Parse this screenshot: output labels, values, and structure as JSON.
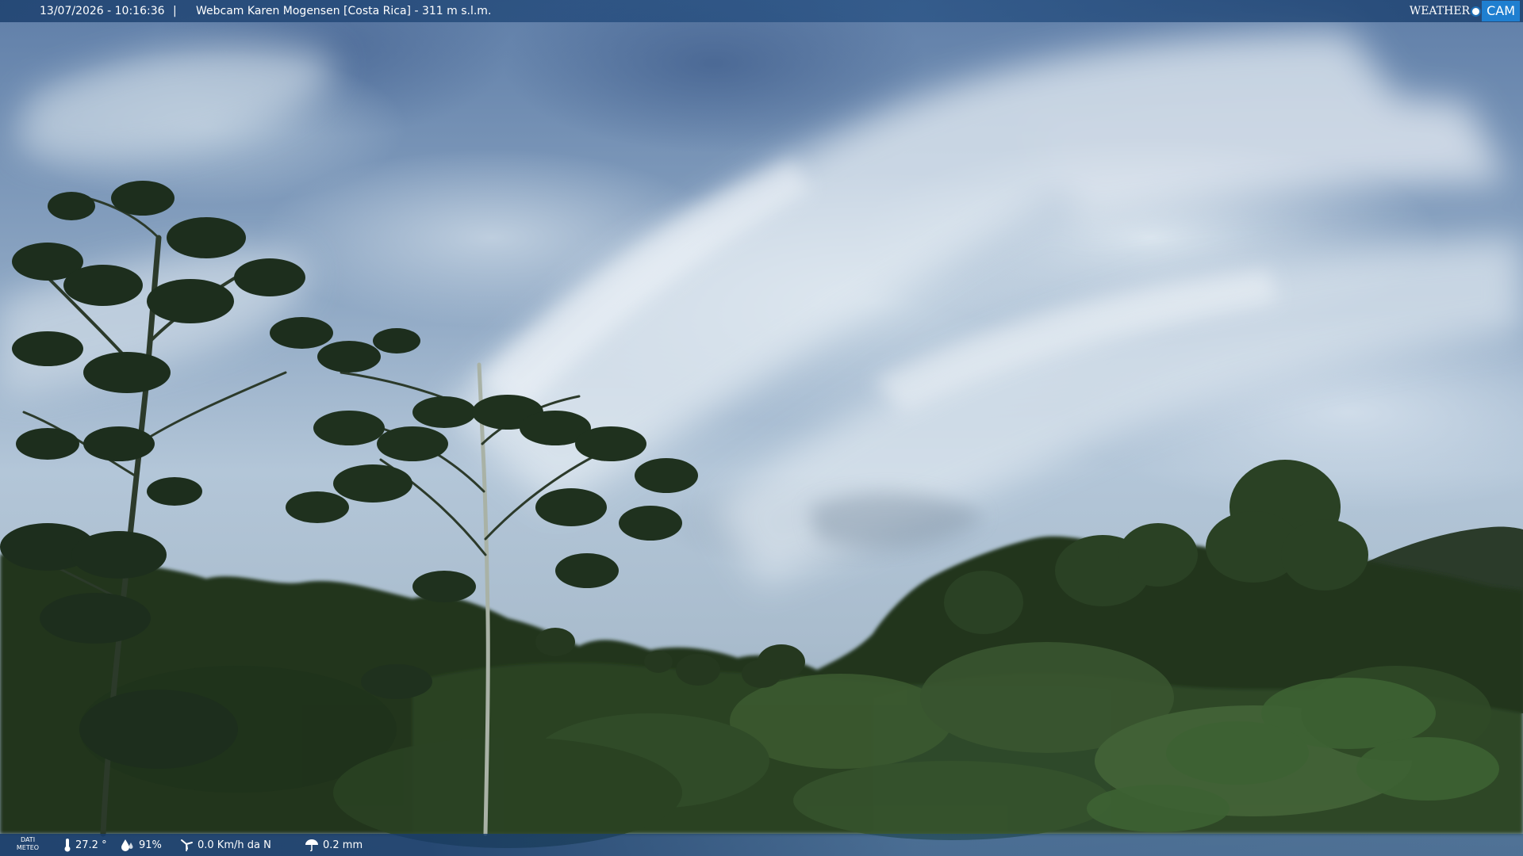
{
  "header": {
    "datetime": "13/07/2026 - 10:16:36",
    "separator": "|",
    "title": "Webcam Karen Mogensen [Costa Rica]  - 311 m s.l.m.",
    "brand_weather": "WEATHER",
    "brand_cam": "CAM"
  },
  "meteo": {
    "label_line1": "DATI",
    "label_line2": "METEO",
    "temperature": "27.2 °",
    "humidity": "91%",
    "wind": "0.0 Km/h da N",
    "rain": "0.2 mm",
    "icons": {
      "temperature": "thermometer-icon",
      "humidity": "humidity-drop-icon",
      "wind": "wind-turbine-icon",
      "rain": "rain-umbrella-icon"
    }
  },
  "scene": {
    "subject": "rainforest",
    "colors": {
      "sky_top": "#5f7ea8",
      "sky_mid": "#b3c6d8",
      "foliage_dark": "#1c2c18",
      "foliage_mid": "#2f4a24",
      "foliage_light": "#4f6e3a"
    }
  }
}
